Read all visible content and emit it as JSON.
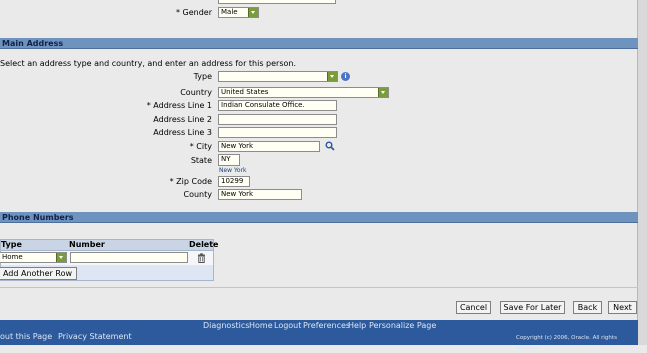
{
  "top": {
    "gender_label": "* Gender",
    "gender_value": "Male"
  },
  "main_address": {
    "header": "Main Address",
    "instruction": "Select an address type and country, and enter an address for this person.",
    "type_label": "Type",
    "type_value": "",
    "country_label": "Country",
    "country_value": "United States",
    "address1_label": "* Address Line 1",
    "address1_value": "Indian Consulate Office.",
    "address2_label": "Address Line 2",
    "address2_value": "",
    "address3_label": "Address Line 3",
    "address3_value": "",
    "city_label": "* City",
    "city_value": "New York",
    "state_label": "State",
    "state_value": "NY",
    "state_hint": "New York",
    "zip_label": "* Zip Code",
    "zip_value": "10299",
    "county_label": "County",
    "county_value": "New York"
  },
  "phone_numbers": {
    "header": "Phone Numbers",
    "columns": [
      "Type",
      "Number",
      "Delete"
    ],
    "rows": [
      {
        "type": "Home",
        "number": ""
      }
    ],
    "add_row_label": "Add Another Row"
  },
  "actions": {
    "cancel": "Cancel",
    "save_later": "Save For Later",
    "back": "Back",
    "next": "Next"
  },
  "footer": {
    "links": [
      "Diagnostics",
      "Home",
      "Logout",
      "Preferences",
      "Help",
      "Personalize Page"
    ],
    "about": "out this Page",
    "privacy": "Privacy Statement",
    "copyright": "Copyright (c) 2006, Oracle. All rights reserved."
  }
}
